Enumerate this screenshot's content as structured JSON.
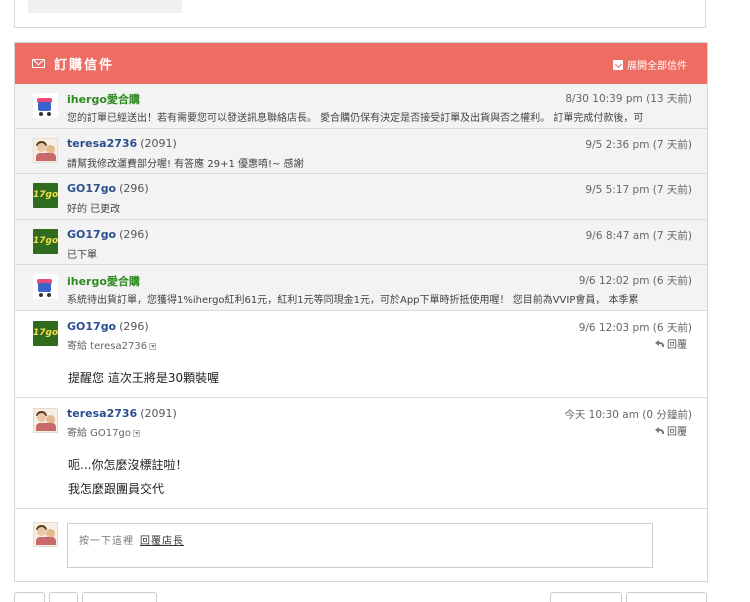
{
  "header": {
    "title": "訂購信件",
    "expand_label": "展開全部信件"
  },
  "messages": [
    {
      "sender": "ihergo愛合購",
      "score": "",
      "time": "8/30  10:39 pm (13 天前)",
      "snippet": "您的訂單已經送出！若有需要您可以發送訊息聯絡店長。 愛合購仍保有決定是否接受訂單及出貨與否之權利。 訂單完成付款後，可"
    },
    {
      "sender": "teresa2736",
      "score": "(2091)",
      "time": "9/5  2:36 pm (7 天前)",
      "snippet": "請幫我修改運費部分喔! 有答應 29+1 優惠唷!~ 感謝"
    },
    {
      "sender": "GO17go",
      "score": "(296)",
      "time": "9/5  5:17 pm (7 天前)",
      "snippet": "好的 已更改"
    },
    {
      "sender": "GO17go",
      "score": "(296)",
      "time": "9/6  8:47 am (7 天前)",
      "snippet": "已下單"
    },
    {
      "sender": "ihergo愛合購",
      "score": "",
      "time": "9/6  12:02 pm (6 天前)",
      "snippet": "系統待出貨訂單，您獲得1%ihergo紅利61元，紅利1元等同現金1元，可於App下單時折抵使用喔！ 您目前為VVIP會員， 本季累"
    },
    {
      "sender": "GO17go",
      "score": "(296)",
      "time": "9/6  12:03 pm (6 天前)",
      "to": "寄給 teresa2736",
      "reply": "回覆",
      "body": [
        "提醒您 這次王將是30顆裝喔"
      ]
    },
    {
      "sender": "teresa2736",
      "score": "(2091)",
      "time": "今天  10:30 am (0 分鐘前)",
      "to": "寄給 GO17go",
      "reply": "回覆",
      "body": [
        "呃...你怎麼沒標註啦！",
        "我怎麼跟團員交代"
      ]
    }
  ],
  "compose": {
    "hint": "按一下這裡",
    "link": "回覆店長"
  },
  "icons": {
    "mail": "mail-icon",
    "download": "download-icon",
    "reply": "reply-icon",
    "caret": "caret-down-icon"
  },
  "colors": {
    "header_bg": "#ee6d63",
    "sender_blue": "#2c4f8f",
    "sender_green": "#2f8a21",
    "collapsed_bg": "#f3f3f3"
  }
}
